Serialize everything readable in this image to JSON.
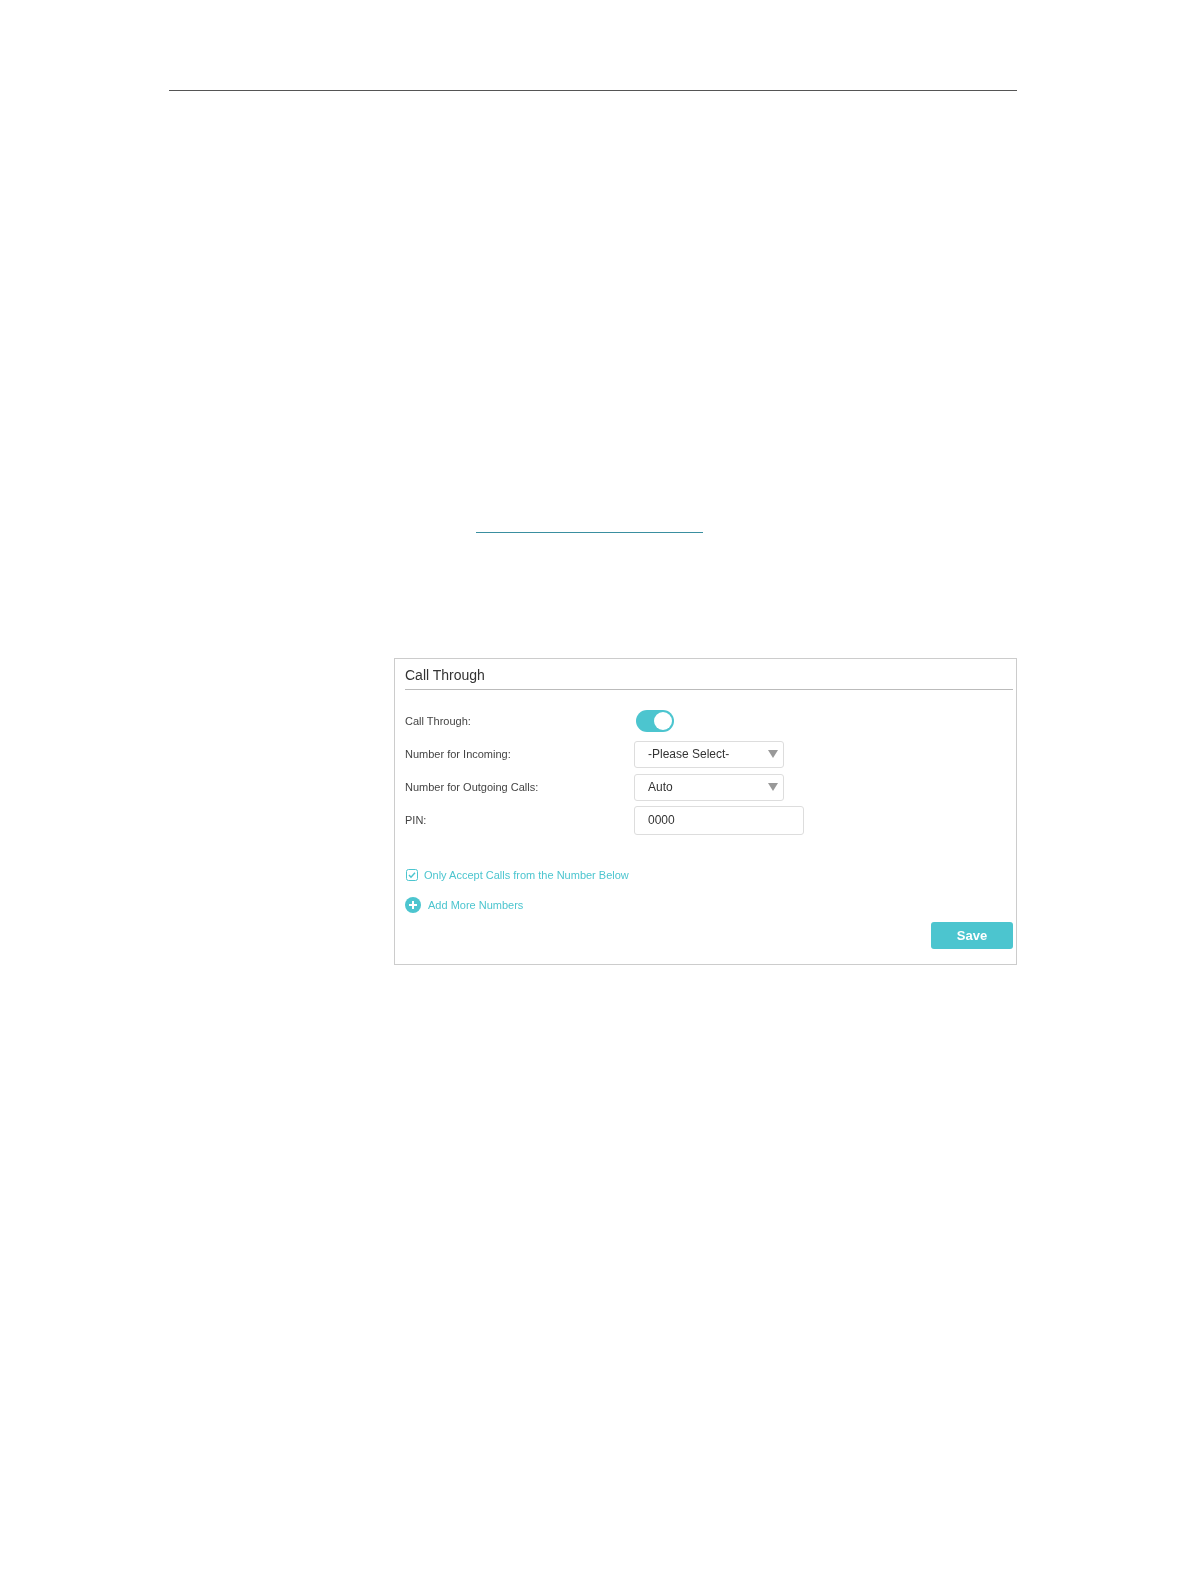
{
  "panel": {
    "title": "Call Through",
    "fields": [
      {
        "kind": "toggle",
        "label": "Call Through:",
        "on": true
      },
      {
        "kind": "select",
        "label": "Number for Incoming:",
        "value": "-Please Select-"
      },
      {
        "kind": "select",
        "label": "Number for Outgoing Calls:",
        "value": "Auto"
      },
      {
        "kind": "text",
        "label": "PIN:",
        "value": "0000"
      }
    ],
    "checkbox": {
      "label": "Only Accept Calls from the Number Below",
      "checked": true
    },
    "add_link": "Add More Numbers",
    "save_button": "Save"
  }
}
